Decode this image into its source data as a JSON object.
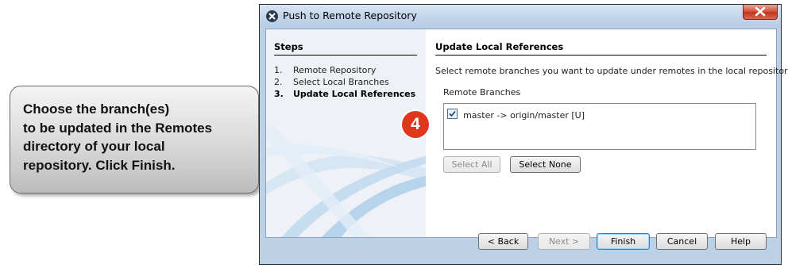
{
  "callout": {
    "lines": [
      "Choose the branch(es)",
      "to be updated in the Remotes",
      "directory of your local",
      "repository. Click Finish."
    ]
  },
  "step_badge": "4",
  "dialog": {
    "title": "Push to Remote Repository",
    "close_icon": "close-x-icon",
    "steps": {
      "header": "Steps",
      "items": [
        {
          "num": "1.",
          "label": "Remote Repository"
        },
        {
          "num": "2.",
          "label": "Select Local Branches"
        },
        {
          "num": "3.",
          "label": "Update Local References",
          "current": true
        }
      ]
    },
    "panel": {
      "title": "Update Local References",
      "instruction": "Select remote branches you want to update under remotes in the local repository",
      "list_label": "Remote Branches",
      "branches": [
        {
          "checked": true,
          "text": "master -> origin/master [U]"
        }
      ],
      "select_all": "Select All",
      "select_none": "Select None"
    },
    "footer": {
      "back": "< Back",
      "next": "Next >",
      "finish": "Finish",
      "cancel": "Cancel",
      "help": "Help"
    }
  }
}
